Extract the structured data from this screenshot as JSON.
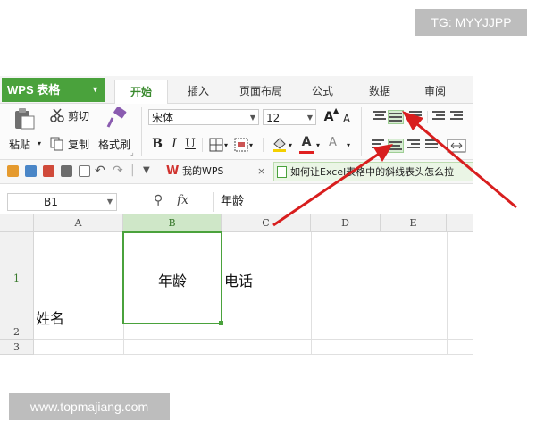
{
  "watermarks": {
    "top": "TG: MYYJJPP",
    "bottom": "www.topmajiang.com"
  },
  "app": {
    "brand": "WPS 表格",
    "tabs": [
      "开始",
      "插入",
      "页面布局",
      "公式",
      "数据",
      "审阅"
    ]
  },
  "ribbon": {
    "cut": "剪切",
    "copy": "复制",
    "paste": "粘贴",
    "format_painter": "格式刷",
    "font_name": "宋体",
    "font_size": "12",
    "grow_font": "A",
    "shrink_font": "A",
    "bold": "B",
    "italic": "I",
    "underline": "U",
    "font_color_glyph": "A"
  },
  "quickbar": {
    "doc_tabs": [
      {
        "label": "我的WPS",
        "close": "×"
      },
      {
        "label": "如何让Excel表格中的斜线表头怎么拉"
      }
    ]
  },
  "formula_bar": {
    "name_box": "B1",
    "fx": "fx",
    "content": "年龄"
  },
  "sheet": {
    "columns": [
      "A",
      "B",
      "C",
      "D",
      "E"
    ],
    "rows": [
      "1",
      "2",
      "3"
    ],
    "selected_cell": "B1",
    "cells": {
      "A1": "姓名",
      "B1": "年龄",
      "C1": "电话"
    }
  },
  "colors": {
    "accent": "#4aa23c",
    "arrow": "#d81e1e"
  }
}
